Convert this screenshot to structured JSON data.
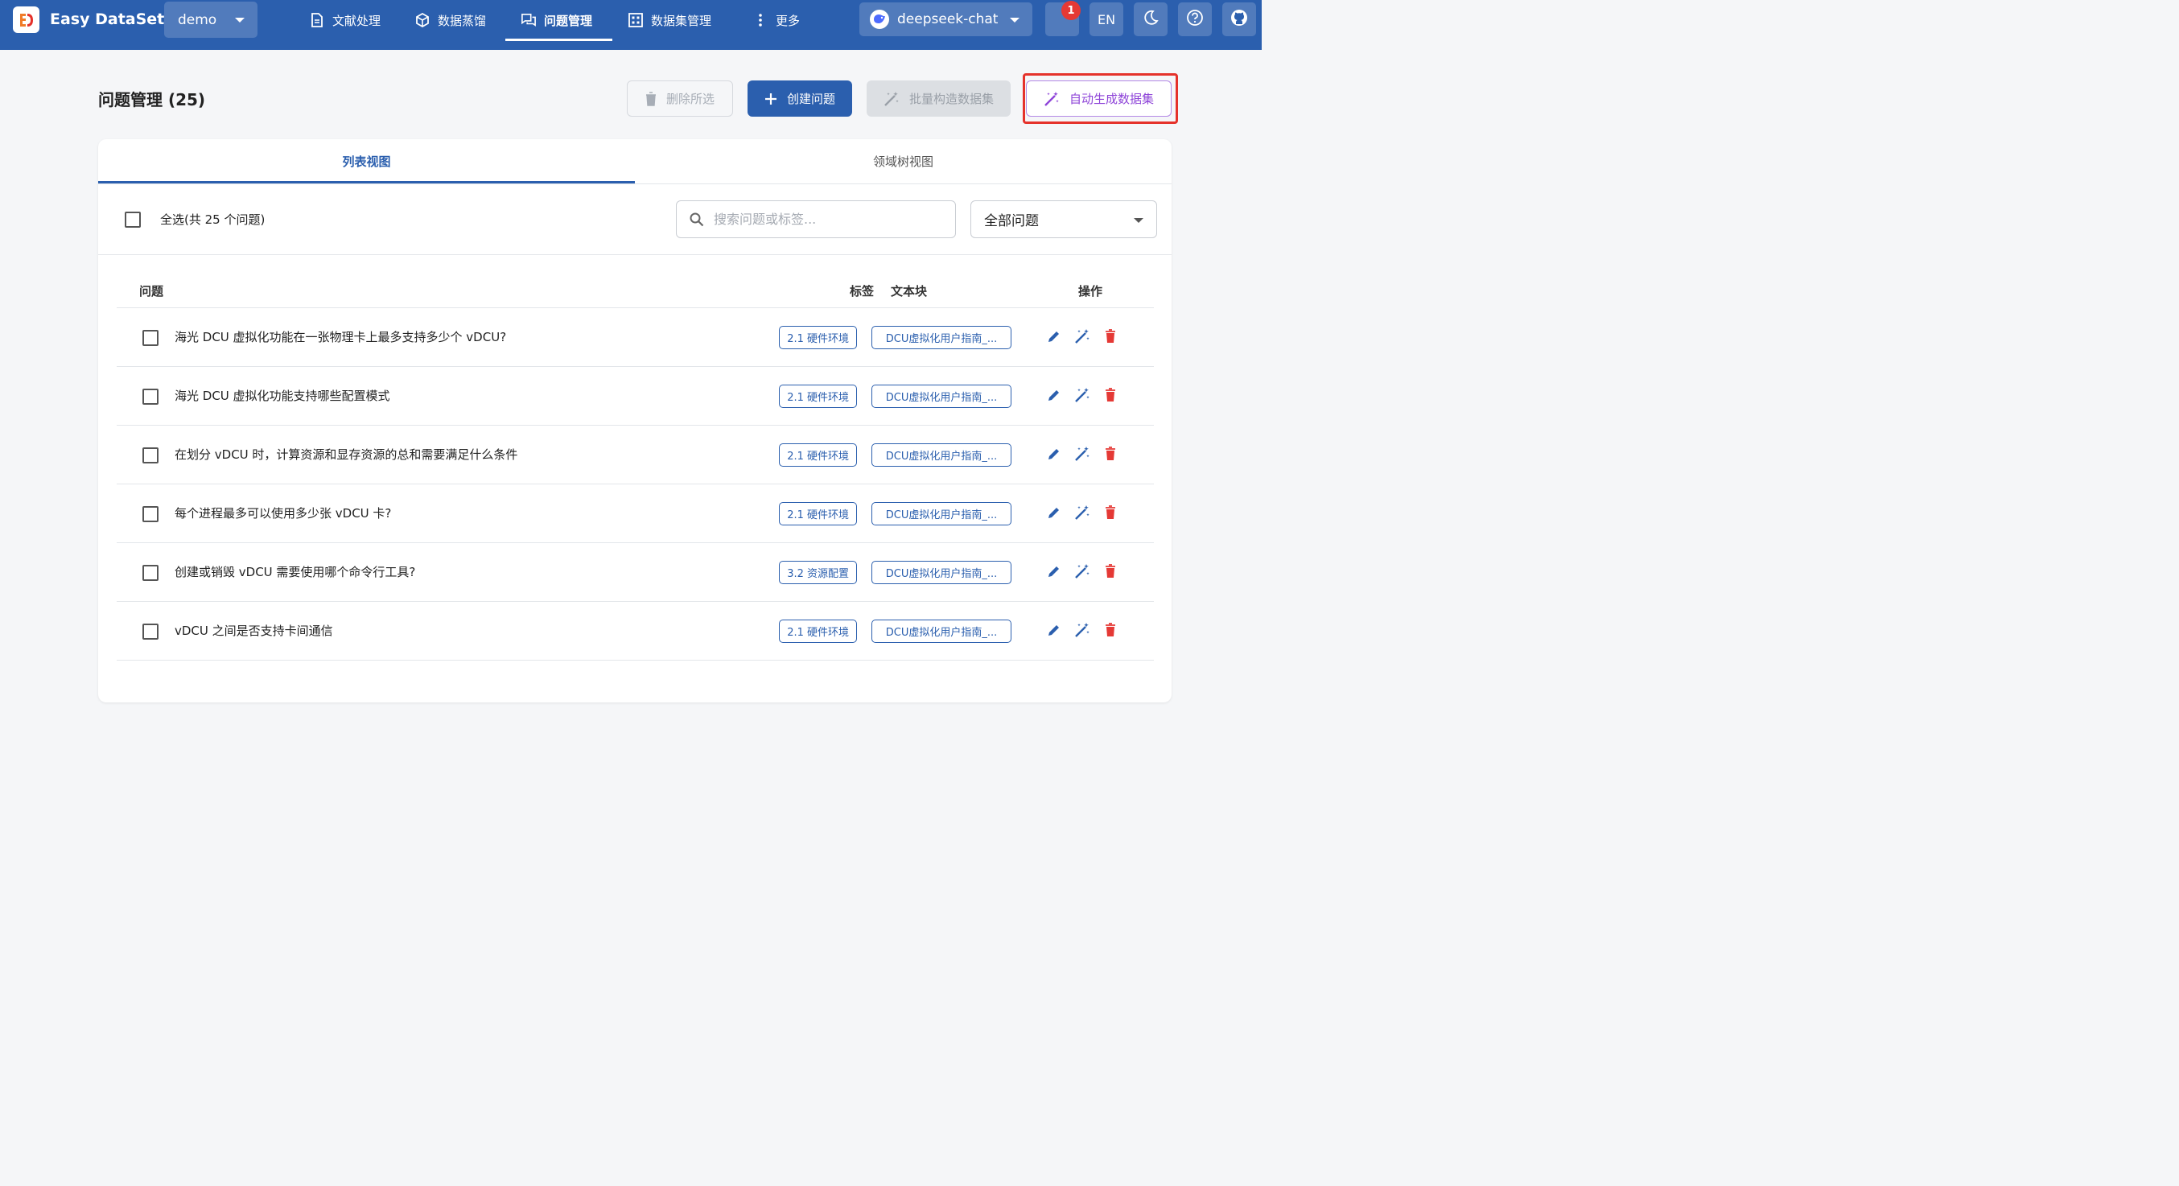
{
  "app": {
    "name": "Easy DataSet",
    "project": "demo"
  },
  "nav": [
    {
      "label": "文献处理",
      "icon": "document-icon"
    },
    {
      "label": "数据蒸馏",
      "icon": "cube-icon"
    },
    {
      "label": "问题管理",
      "icon": "chat-icon",
      "active": true
    },
    {
      "label": "数据集管理",
      "icon": "grid-icon"
    },
    {
      "label": "更多",
      "icon": "more-vert-icon"
    }
  ],
  "model": {
    "name": "deepseek-chat"
  },
  "topbar_actions": {
    "notification_count": "1",
    "language": "EN"
  },
  "page": {
    "title": "问题管理 (25)",
    "delete_label": "删除所选",
    "create_label": "创建问题",
    "batch_label": "批量构造数据集",
    "auto_label": "自动生成数据集"
  },
  "tabs": {
    "list": "列表视图",
    "tree": "领域树视图"
  },
  "toolbar": {
    "select_all": "全选(共 25 个问题)",
    "search_placeholder": "搜索问题或标签...",
    "filter_value": "全部问题"
  },
  "table": {
    "headers": {
      "question": "问题",
      "tag": "标签",
      "chunk": "文本块",
      "actions": "操作"
    },
    "rows": [
      {
        "question": "海光 DCU 虚拟化功能在一张物理卡上最多支持多少个 vDCU?",
        "tag": "2.1 硬件环境",
        "chunk": "DCU虚拟化用户指南_..."
      },
      {
        "question": "海光 DCU 虚拟化功能支持哪些配置模式",
        "tag": "2.1 硬件环境",
        "chunk": "DCU虚拟化用户指南_..."
      },
      {
        "question": "在划分 vDCU 时，计算资源和显存资源的总和需要满足什么条件",
        "tag": "2.1 硬件环境",
        "chunk": "DCU虚拟化用户指南_..."
      },
      {
        "question": "每个进程最多可以使用多少张 vDCU 卡?",
        "tag": "2.1 硬件环境",
        "chunk": "DCU虚拟化用户指南_..."
      },
      {
        "question": "创建或销毁 vDCU 需要使用哪个命令行工具?",
        "tag": "3.2 资源配置",
        "chunk": "DCU虚拟化用户指南_..."
      },
      {
        "question": "vDCU 之间是否支持卡间通信",
        "tag": "2.1 硬件环境",
        "chunk": "DCU虚拟化用户指南_..."
      }
    ]
  },
  "colors": {
    "primary": "#2b5fae",
    "accent_purple": "#8e44d8",
    "danger": "#e53935",
    "highlight": "#e5322b"
  }
}
